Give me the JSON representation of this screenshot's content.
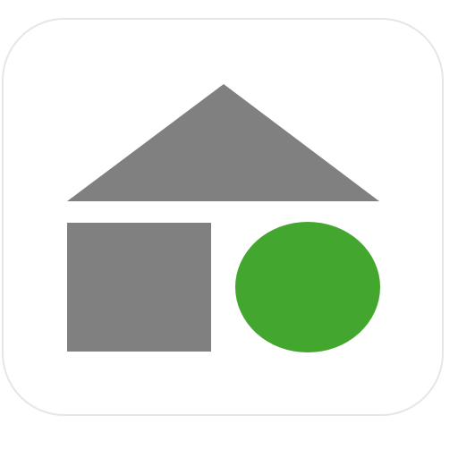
{
  "icon": {
    "name": "house-icon",
    "parts": [
      "roof",
      "wall-block",
      "green-circle"
    ],
    "colors": {
      "tile_background": "#ffffff",
      "tile_border": "#e6e6e6",
      "roof": "#808080",
      "block": "#808080",
      "circle": "#43a62e"
    }
  }
}
